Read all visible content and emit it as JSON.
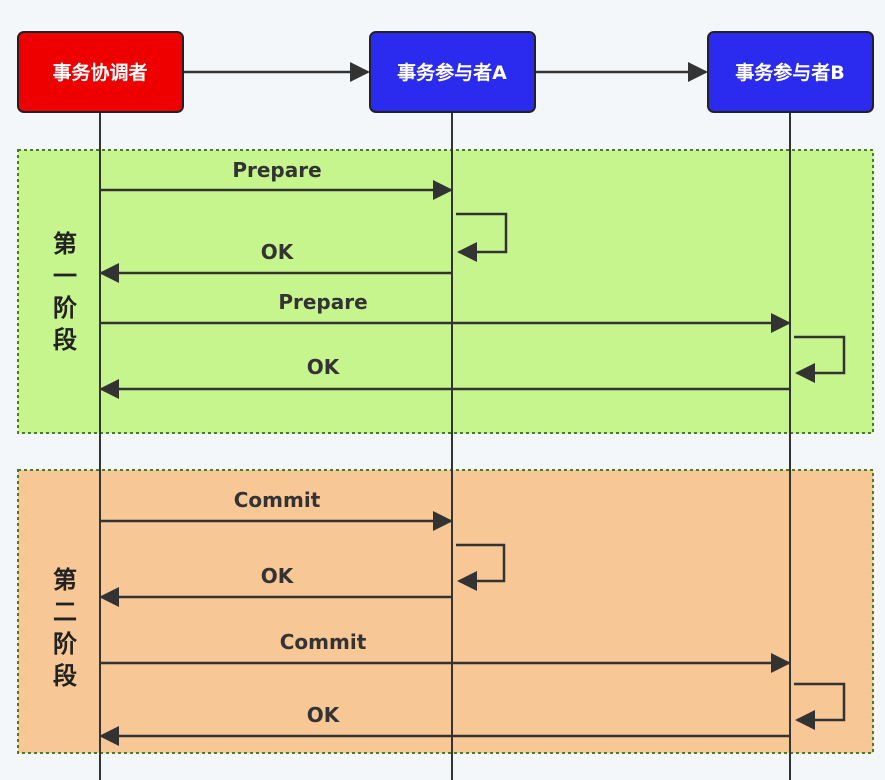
{
  "participants": {
    "coordinator": {
      "label": "事务协调者",
      "color": "#ee0000"
    },
    "participant_a": {
      "label": "事务参与者A",
      "color": "#2b2bef"
    },
    "participant_b": {
      "label": "事务参与者B",
      "color": "#2b2bef"
    }
  },
  "phase1": {
    "label_chars": [
      "第",
      "一",
      "阶",
      "段"
    ],
    "color": "#c6f58e",
    "messages": {
      "prepare_a": "Prepare",
      "ok_a": "OK",
      "prepare_b": "Prepare",
      "ok_b": "OK"
    }
  },
  "phase2": {
    "label_chars": [
      "第",
      "二",
      "阶",
      "段"
    ],
    "color": "#f7c796",
    "messages": {
      "commit_a": "Commit",
      "ok_a": "OK",
      "commit_b": "Commit",
      "ok_b": "OK"
    }
  }
}
